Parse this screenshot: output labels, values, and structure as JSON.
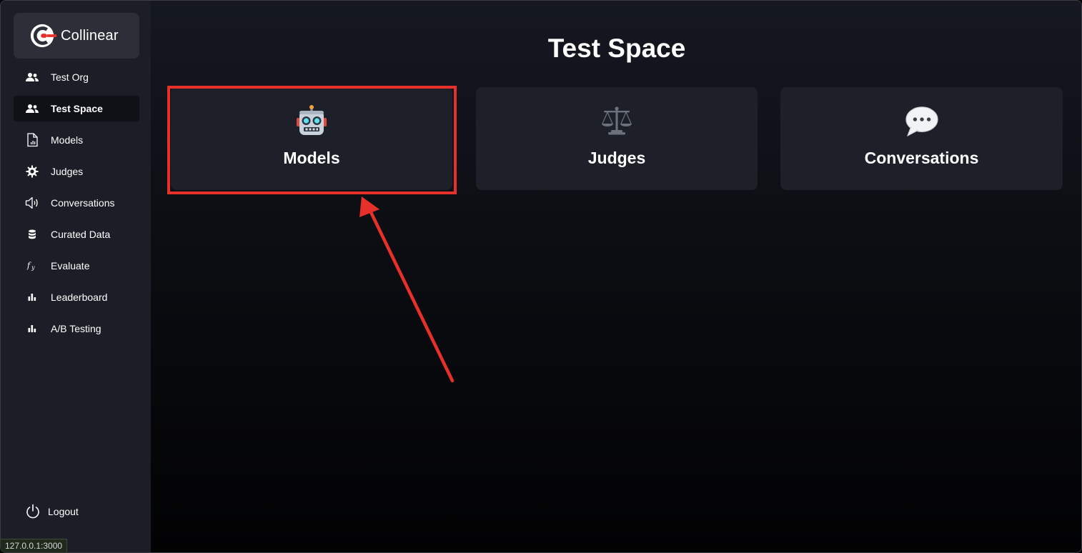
{
  "brand": {
    "name": "Collinear",
    "accent": "#e8302b"
  },
  "sidebar": {
    "items": [
      {
        "label": "Test Org",
        "icon": "users-icon",
        "active": false
      },
      {
        "label": "Test Space",
        "icon": "users-icon",
        "active": true
      },
      {
        "label": "Models",
        "icon": "document-chart-icon",
        "active": false
      },
      {
        "label": "Judges",
        "icon": "gear-icon",
        "active": false
      },
      {
        "label": "Conversations",
        "icon": "speaker-icon",
        "active": false
      },
      {
        "label": "Curated Data",
        "icon": "database-icon",
        "active": false
      },
      {
        "label": "Evaluate",
        "icon": "function-icon",
        "active": false
      },
      {
        "label": "Leaderboard",
        "icon": "bar-chart-icon",
        "active": false
      },
      {
        "label": "A/B Testing",
        "icon": "bar-chart-icon",
        "active": false
      }
    ],
    "logout_label": "Logout"
  },
  "main": {
    "title": "Test Space",
    "cards": [
      {
        "label": "Models",
        "icon": "robot-icon"
      },
      {
        "label": "Judges",
        "icon": "scales-icon"
      },
      {
        "label": "Conversations",
        "icon": "speech-bubble-icon"
      }
    ]
  },
  "status_bar": {
    "url": "127.0.0.1:3000"
  }
}
